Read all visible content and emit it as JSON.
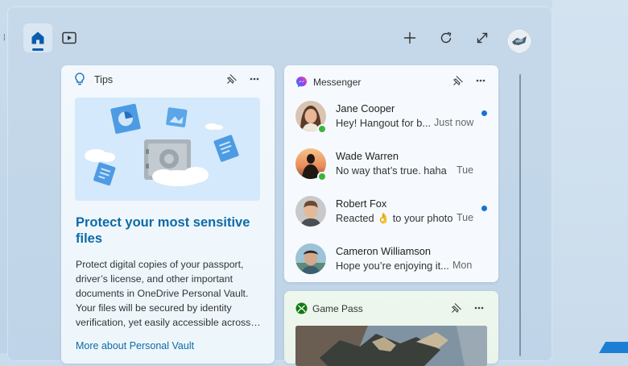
{
  "nav": {
    "home_icon": "home-icon",
    "video_icon": "video-icon"
  },
  "toolbar": {
    "add_icon": "plus-icon",
    "refresh_icon": "refresh-icon",
    "expand_icon": "expand-icon",
    "avatar": "user-avatar"
  },
  "tips": {
    "title": "Tips",
    "headline": "Protect your most sensitive files",
    "body": "Protect digital copies of your passport, driver’s license, and other important documents in OneDrive Personal Vault. Your files will be secured by identity verification, yet easily accessible across…",
    "link": "More about Personal Vault"
  },
  "messenger": {
    "title": "Messenger",
    "messages": [
      {
        "name": "Jane Cooper",
        "text": "Hey! Hangout for b...",
        "time": "Just now",
        "unread": true,
        "online": true
      },
      {
        "name": "Wade Warren",
        "text": "No way that’s true. haha",
        "time": "Tue",
        "unread": false,
        "online": true
      },
      {
        "name": "Robert Fox",
        "text_before": "Reacted",
        "emoji": "👌",
        "text_after": "to your photo",
        "time": "Tue",
        "unread": true,
        "online": false
      },
      {
        "name": "Cameron Williamson",
        "text": "Hope you’re enjoying it...",
        "time": "Mon",
        "unread": false,
        "online": false
      }
    ]
  },
  "gamepass": {
    "title": "Game Pass"
  },
  "colors": {
    "accent": "#0d6aa8",
    "unread": "#1872d6",
    "online": "#3cb43c"
  }
}
